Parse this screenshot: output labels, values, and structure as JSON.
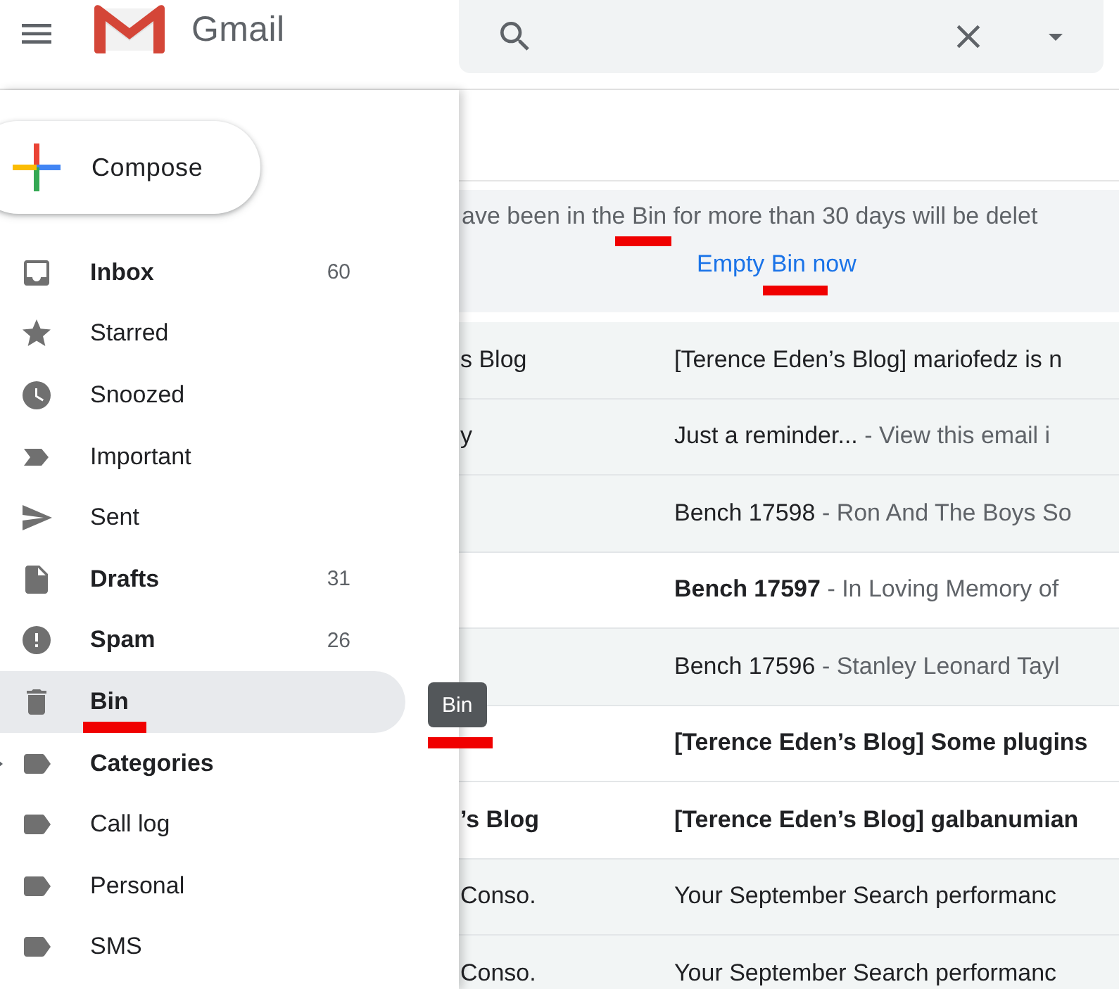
{
  "header": {
    "brand": "Gmail"
  },
  "drawer": {
    "compose": "Compose",
    "items": [
      {
        "label": "Inbox",
        "kind": "inbox",
        "count": "60",
        "unread": true,
        "selected": false
      },
      {
        "label": "Starred",
        "kind": "star",
        "unread": false,
        "selected": false
      },
      {
        "label": "Snoozed",
        "kind": "clock",
        "unread": false,
        "selected": false
      },
      {
        "label": "Important",
        "kind": "important",
        "unread": false,
        "selected": false
      },
      {
        "label": "Sent",
        "kind": "send",
        "unread": false,
        "selected": false
      },
      {
        "label": "Drafts",
        "kind": "draft",
        "count": "31",
        "unread": true,
        "selected": false
      },
      {
        "label": "Spam",
        "kind": "spam",
        "count": "26",
        "unread": true,
        "selected": false
      },
      {
        "label": "Bin",
        "kind": "trash",
        "unread": true,
        "selected": true,
        "underlined": true
      },
      {
        "label": "Categories",
        "kind": "label",
        "unread": true,
        "selected": false,
        "expandable": true
      },
      {
        "label": "Call log",
        "kind": "label",
        "unread": false,
        "selected": false
      },
      {
        "label": "Personal",
        "kind": "label",
        "unread": false,
        "selected": false
      },
      {
        "label": "SMS",
        "kind": "label",
        "unread": false,
        "selected": false
      }
    ],
    "tooltip": {
      "text": "Bin",
      "underlined": true
    }
  },
  "notice": {
    "before": "ave been in the ",
    "marked": "Bin",
    "after": " for more than 30 days will be delet",
    "link": {
      "before": "Empty ",
      "marked": "Bin",
      "after": " now"
    }
  },
  "rows": [
    {
      "sender": "s Blog",
      "subject": "[Terence Eden’s Blog] mariofedz is n",
      "unread": false
    },
    {
      "sender": "y",
      "subject": "Just a reminder...",
      "snippet": "- View this email i",
      "unread": false
    },
    {
      "subject": "Bench 17598",
      "snippet": "- Ron And The Boys So",
      "unread": false
    },
    {
      "subject": "Bench 17597",
      "snippet": "- In Loving Memory of",
      "unread": true
    },
    {
      "subject": "Bench 17596",
      "snippet": "- Stanley Leonard Tayl",
      "unread": false
    },
    {
      "subject": "[Terence Eden’s Blog] Some plugins",
      "unread": true
    },
    {
      "sender": "’s Blog",
      "subject": "[Terence Eden’s Blog] galbanumian",
      "unread": true
    },
    {
      "sender": "Conso.",
      "subject": "Your September Search performanc",
      "unread": false
    },
    {
      "sender": "Conso.",
      "subject": "Your September Search performanc",
      "unread": false
    }
  ]
}
